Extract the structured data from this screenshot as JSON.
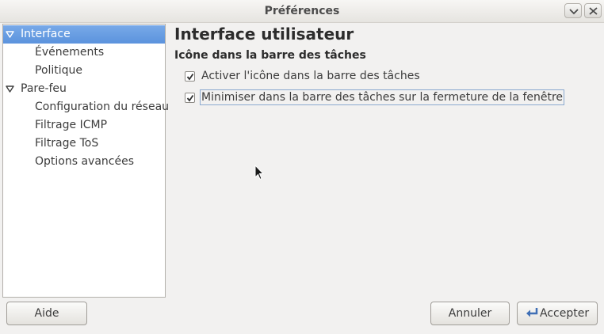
{
  "window": {
    "title": "Préférences"
  },
  "sidebar": {
    "items": [
      {
        "label": "Interface",
        "level": 0,
        "expanded": true,
        "selected": true
      },
      {
        "label": "Événements",
        "level": 1
      },
      {
        "label": "Politique",
        "level": 1
      },
      {
        "label": "Pare-feu",
        "level": 0,
        "expanded": true
      },
      {
        "label": "Configuration du réseau",
        "level": 1
      },
      {
        "label": "Filtrage ICMP",
        "level": 1
      },
      {
        "label": "Filtrage ToS",
        "level": 1
      },
      {
        "label": "Options avancées",
        "level": 1
      }
    ]
  },
  "main": {
    "title": "Interface utilisateur",
    "section": "Icône dans la barre des tâches",
    "options": [
      {
        "label": "Activer l'icône dans la barre des tâches",
        "checked": true
      },
      {
        "label": "Minimiser dans la barre des tâches sur la fermeture de la fenêtre",
        "checked": true,
        "focused": true
      }
    ]
  },
  "buttons": {
    "help": "Aide",
    "cancel": "Annuler",
    "accept": "Accepter"
  },
  "colors": {
    "selection": "#6aa0e3",
    "window_bg": "#f2f1f0"
  }
}
